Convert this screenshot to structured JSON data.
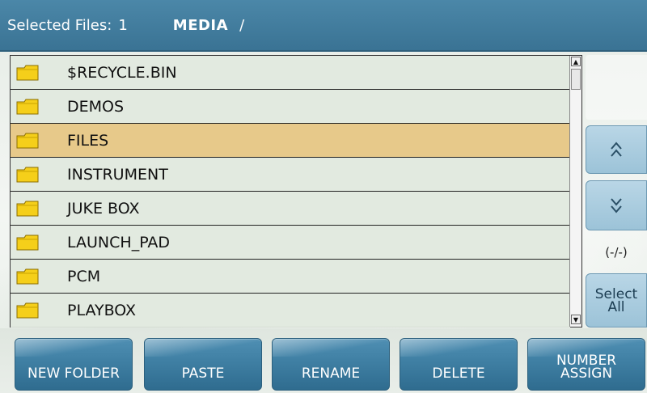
{
  "header": {
    "selected_label": "Selected Files:",
    "selected_count": "1",
    "path_name": "MEDIA",
    "path_sep": "/"
  },
  "files": [
    {
      "name": "$RECYCLE.BIN",
      "icon": "folder-icon",
      "selected": false
    },
    {
      "name": "DEMOS",
      "icon": "folder-icon",
      "selected": false
    },
    {
      "name": "FILES",
      "icon": "folder-icon",
      "selected": true
    },
    {
      "name": "INSTRUMENT",
      "icon": "folder-icon",
      "selected": false
    },
    {
      "name": "JUKE BOX",
      "icon": "folder-icon",
      "selected": false
    },
    {
      "name": "LAUNCH_PAD",
      "icon": "folder-icon",
      "selected": false
    },
    {
      "name": "PCM",
      "icon": "folder-icon",
      "selected": false
    },
    {
      "name": "PLAYBOX",
      "icon": "folder-icon",
      "selected": false
    }
  ],
  "side": {
    "page_up_glyph": "^^",
    "page_down_glyph": "vv",
    "counter": "(-/-)",
    "select_all_line1": "Select",
    "select_all_line2": "All"
  },
  "toolbar": {
    "new_folder": "NEW FOLDER",
    "paste": "PASTE",
    "rename": "RENAME",
    "delete": "DELETE",
    "number_assign_line1": "NUMBER",
    "number_assign_line2": "ASSIGN"
  },
  "colors": {
    "header": "#3f7b9c",
    "selected_row": "#e7c98a",
    "button": "#3f7fa3",
    "folder": "#f5cf1a"
  }
}
